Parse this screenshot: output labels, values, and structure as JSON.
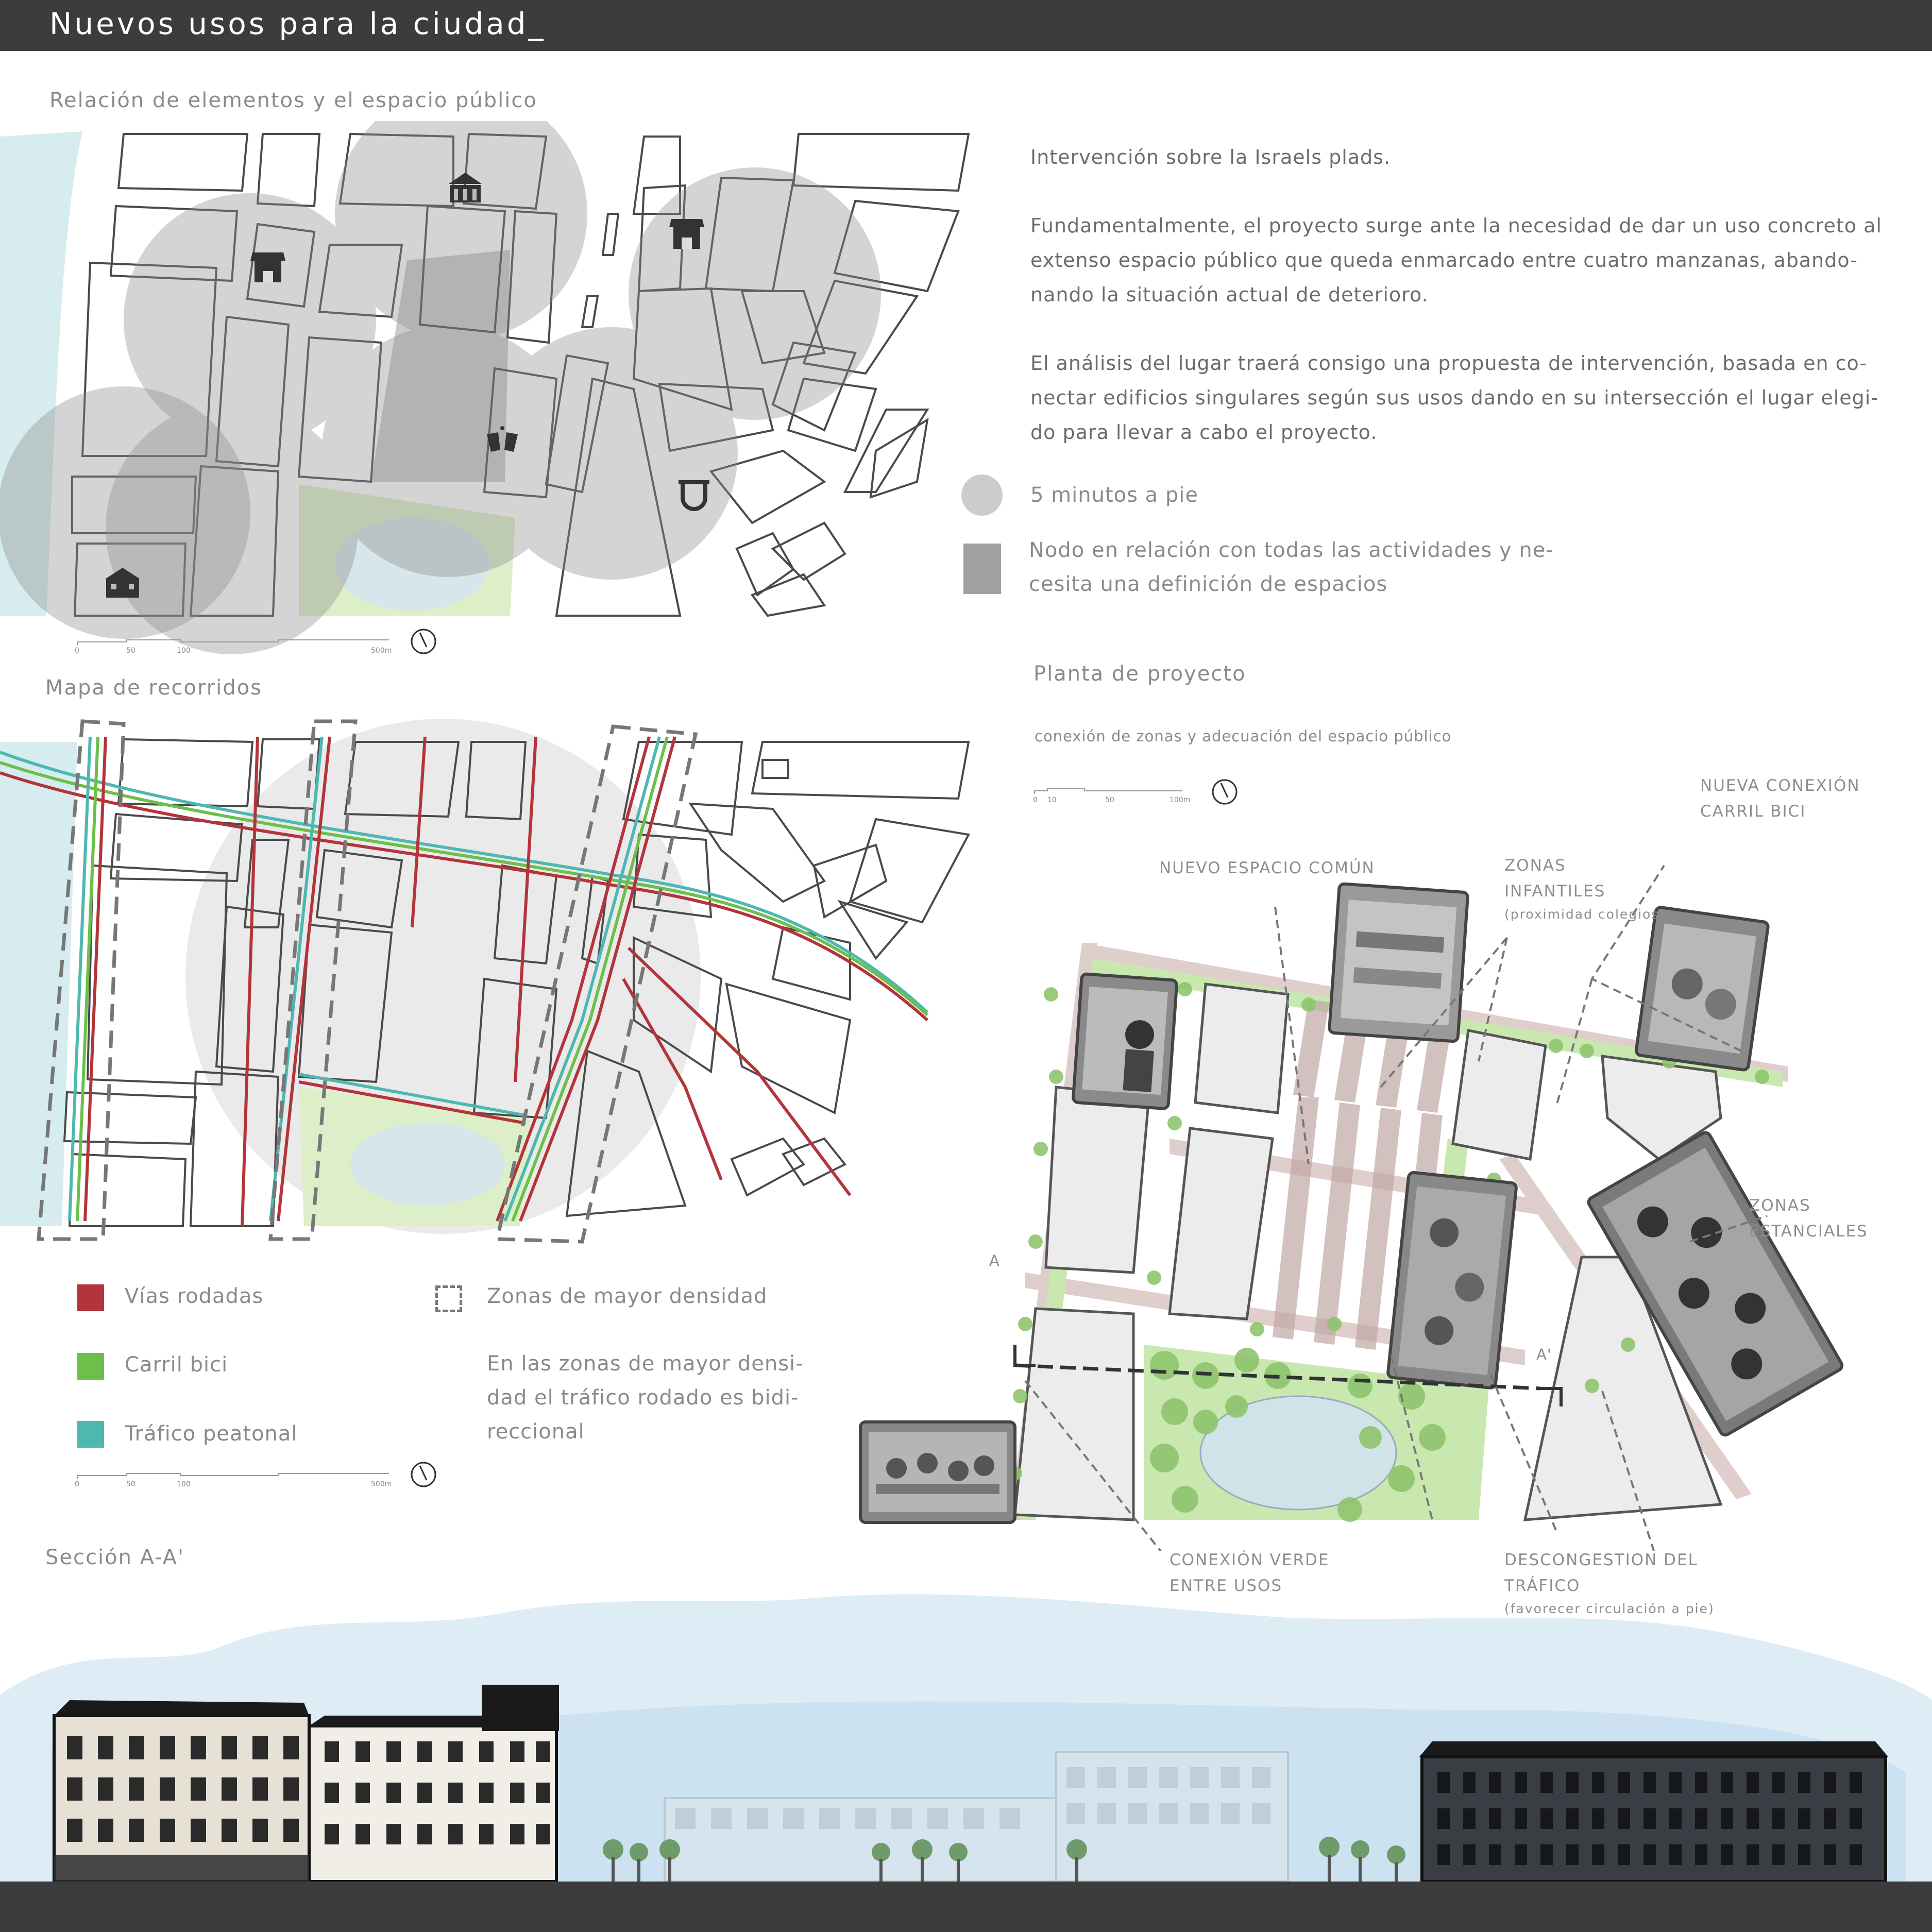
{
  "header": {
    "title": "Nuevos usos para la ciudad_"
  },
  "map1": {
    "title": "Relación de elementos  y el espacio público",
    "scale_ticks": [
      "0",
      "50",
      "100",
      "500m"
    ]
  },
  "intro": {
    "p1": "Intervención sobre la Israels plads.",
    "p2_l1": "Fundamentalmente, el proyecto surge ante la necesidad de dar un uso concreto al",
    "p2_l2": "extenso espacio público que queda enmarcado entre cuatro manzanas, abando-",
    "p2_l3": "nando la situación actual de deterioro.",
    "p3_l1": "El análisis del lugar traerá consigo una propuesta de intervención, basada en co-",
    "p3_l2": "nectar edificios singulares según sus usos dando en su intersección el lugar elegi-",
    "p3_l3": "do para llevar a cabo el proyecto."
  },
  "legend1": {
    "circle": "5 minutos a pie",
    "node_l1": "Nodo en relación con todas las actividades y ne-",
    "node_l2": "cesita una definición de espacios"
  },
  "map2": {
    "title": "Mapa de recorridos",
    "scale_ticks": [
      "0",
      "50",
      "100",
      "500m"
    ]
  },
  "legend2": {
    "roads": "Vías rodadas",
    "bike": "Carril bici",
    "pedestrian": "Tráfico peatonal",
    "density": "Zonas de mayor densidad",
    "note_l1": "En las zonas de mayor densi-",
    "note_l2": "dad el tráfico rodado es bidi-",
    "note_l3": "reccional"
  },
  "colors": {
    "roads": "#b3343a",
    "bike": "#6cbf4a",
    "pedestrian": "#4db8b0",
    "water": "#d6ecef",
    "park": "#dcefc8",
    "circle": "#9a9a9a",
    "topbar": "#3c3c3c"
  },
  "plan": {
    "title": "Planta de proyecto",
    "subtitle": "conexión de zonas y adecuación del espacio público",
    "scale_ticks": [
      "0",
      "10",
      "50",
      "100m"
    ],
    "callouts": {
      "nuevo_espacio": "NUEVO ESPACIO COMÚN",
      "zonas_inf_l1": "ZONAS",
      "zonas_inf_l2": "INFANTILES",
      "zonas_inf_sub": "(proximidad colegios)",
      "bici_l1": "NUEVA CONEXIÓN",
      "bici_l2": "CARRIL BICI",
      "estanciales_l1": "ZONAS",
      "estanciales_l2": "ESTANCIALES",
      "verde_l1": "CONEXIÓN VERDE",
      "verde_l2": "ENTRE USOS",
      "descong_l1": "DESCONGESTION DEL",
      "descong_l2": "TRÁFICO",
      "descong_sub": "(favorecer circulación a pie)"
    },
    "section_marks": [
      "A",
      "A'"
    ]
  },
  "section": {
    "title": "Sección A-A'"
  },
  "icons": [
    "shop-icon",
    "museum-icon",
    "bar-icon",
    "university-icon",
    "school-icon"
  ]
}
